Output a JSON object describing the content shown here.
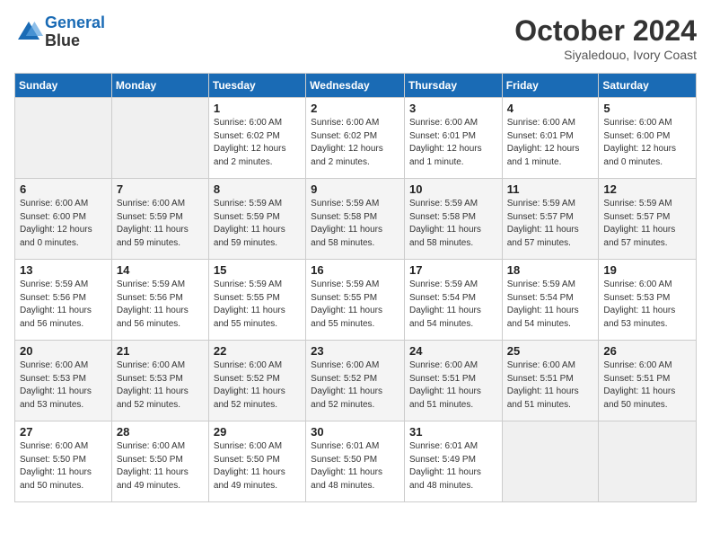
{
  "header": {
    "logo_line1": "General",
    "logo_line2": "Blue",
    "month_title": "October 2024",
    "subtitle": "Siyaledouo, Ivory Coast"
  },
  "days_of_week": [
    "Sunday",
    "Monday",
    "Tuesday",
    "Wednesday",
    "Thursday",
    "Friday",
    "Saturday"
  ],
  "weeks": [
    [
      {
        "day": "",
        "info": ""
      },
      {
        "day": "",
        "info": ""
      },
      {
        "day": "1",
        "info": "Sunrise: 6:00 AM\nSunset: 6:02 PM\nDaylight: 12 hours\nand 2 minutes."
      },
      {
        "day": "2",
        "info": "Sunrise: 6:00 AM\nSunset: 6:02 PM\nDaylight: 12 hours\nand 2 minutes."
      },
      {
        "day": "3",
        "info": "Sunrise: 6:00 AM\nSunset: 6:01 PM\nDaylight: 12 hours\nand 1 minute."
      },
      {
        "day": "4",
        "info": "Sunrise: 6:00 AM\nSunset: 6:01 PM\nDaylight: 12 hours\nand 1 minute."
      },
      {
        "day": "5",
        "info": "Sunrise: 6:00 AM\nSunset: 6:00 PM\nDaylight: 12 hours\nand 0 minutes."
      }
    ],
    [
      {
        "day": "6",
        "info": "Sunrise: 6:00 AM\nSunset: 6:00 PM\nDaylight: 12 hours\nand 0 minutes."
      },
      {
        "day": "7",
        "info": "Sunrise: 6:00 AM\nSunset: 5:59 PM\nDaylight: 11 hours\nand 59 minutes."
      },
      {
        "day": "8",
        "info": "Sunrise: 5:59 AM\nSunset: 5:59 PM\nDaylight: 11 hours\nand 59 minutes."
      },
      {
        "day": "9",
        "info": "Sunrise: 5:59 AM\nSunset: 5:58 PM\nDaylight: 11 hours\nand 58 minutes."
      },
      {
        "day": "10",
        "info": "Sunrise: 5:59 AM\nSunset: 5:58 PM\nDaylight: 11 hours\nand 58 minutes."
      },
      {
        "day": "11",
        "info": "Sunrise: 5:59 AM\nSunset: 5:57 PM\nDaylight: 11 hours\nand 57 minutes."
      },
      {
        "day": "12",
        "info": "Sunrise: 5:59 AM\nSunset: 5:57 PM\nDaylight: 11 hours\nand 57 minutes."
      }
    ],
    [
      {
        "day": "13",
        "info": "Sunrise: 5:59 AM\nSunset: 5:56 PM\nDaylight: 11 hours\nand 56 minutes."
      },
      {
        "day": "14",
        "info": "Sunrise: 5:59 AM\nSunset: 5:56 PM\nDaylight: 11 hours\nand 56 minutes."
      },
      {
        "day": "15",
        "info": "Sunrise: 5:59 AM\nSunset: 5:55 PM\nDaylight: 11 hours\nand 55 minutes."
      },
      {
        "day": "16",
        "info": "Sunrise: 5:59 AM\nSunset: 5:55 PM\nDaylight: 11 hours\nand 55 minutes."
      },
      {
        "day": "17",
        "info": "Sunrise: 5:59 AM\nSunset: 5:54 PM\nDaylight: 11 hours\nand 54 minutes."
      },
      {
        "day": "18",
        "info": "Sunrise: 5:59 AM\nSunset: 5:54 PM\nDaylight: 11 hours\nand 54 minutes."
      },
      {
        "day": "19",
        "info": "Sunrise: 6:00 AM\nSunset: 5:53 PM\nDaylight: 11 hours\nand 53 minutes."
      }
    ],
    [
      {
        "day": "20",
        "info": "Sunrise: 6:00 AM\nSunset: 5:53 PM\nDaylight: 11 hours\nand 53 minutes."
      },
      {
        "day": "21",
        "info": "Sunrise: 6:00 AM\nSunset: 5:53 PM\nDaylight: 11 hours\nand 52 minutes."
      },
      {
        "day": "22",
        "info": "Sunrise: 6:00 AM\nSunset: 5:52 PM\nDaylight: 11 hours\nand 52 minutes."
      },
      {
        "day": "23",
        "info": "Sunrise: 6:00 AM\nSunset: 5:52 PM\nDaylight: 11 hours\nand 52 minutes."
      },
      {
        "day": "24",
        "info": "Sunrise: 6:00 AM\nSunset: 5:51 PM\nDaylight: 11 hours\nand 51 minutes."
      },
      {
        "day": "25",
        "info": "Sunrise: 6:00 AM\nSunset: 5:51 PM\nDaylight: 11 hours\nand 51 minutes."
      },
      {
        "day": "26",
        "info": "Sunrise: 6:00 AM\nSunset: 5:51 PM\nDaylight: 11 hours\nand 50 minutes."
      }
    ],
    [
      {
        "day": "27",
        "info": "Sunrise: 6:00 AM\nSunset: 5:50 PM\nDaylight: 11 hours\nand 50 minutes."
      },
      {
        "day": "28",
        "info": "Sunrise: 6:00 AM\nSunset: 5:50 PM\nDaylight: 11 hours\nand 49 minutes."
      },
      {
        "day": "29",
        "info": "Sunrise: 6:00 AM\nSunset: 5:50 PM\nDaylight: 11 hours\nand 49 minutes."
      },
      {
        "day": "30",
        "info": "Sunrise: 6:01 AM\nSunset: 5:50 PM\nDaylight: 11 hours\nand 48 minutes."
      },
      {
        "day": "31",
        "info": "Sunrise: 6:01 AM\nSunset: 5:49 PM\nDaylight: 11 hours\nand 48 minutes."
      },
      {
        "day": "",
        "info": ""
      },
      {
        "day": "",
        "info": ""
      }
    ]
  ]
}
